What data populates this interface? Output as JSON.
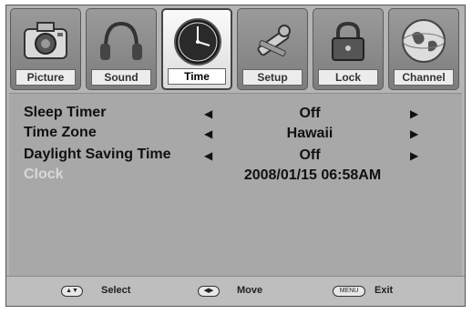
{
  "tabs": [
    {
      "label": "Picture",
      "icon": "camera-icon",
      "active": false
    },
    {
      "label": "Sound",
      "icon": "headphones-icon",
      "active": false
    },
    {
      "label": "Time",
      "icon": "clock-icon",
      "active": true
    },
    {
      "label": "Setup",
      "icon": "tools-icon",
      "active": false
    },
    {
      "label": "Lock",
      "icon": "lock-icon",
      "active": false
    },
    {
      "label": "Channel",
      "icon": "globe-icon",
      "active": false
    }
  ],
  "settings": [
    {
      "name": "Sleep Timer",
      "value": "Off"
    },
    {
      "name": "Time Zone",
      "value": "Hawaii"
    },
    {
      "name": "Daylight Saving Time",
      "value": "Off"
    }
  ],
  "clock": {
    "name": "Clock",
    "value": "2008/01/15  06:58AM"
  },
  "footer": {
    "select_label": "Select",
    "move_label": "Move",
    "menu_key": "MENU",
    "exit_label": "Exit"
  },
  "colors": {
    "screen_bg": "#b4b4b4",
    "panel_bg": "#a8a8a8",
    "clock_label": "#d8d8d8"
  }
}
